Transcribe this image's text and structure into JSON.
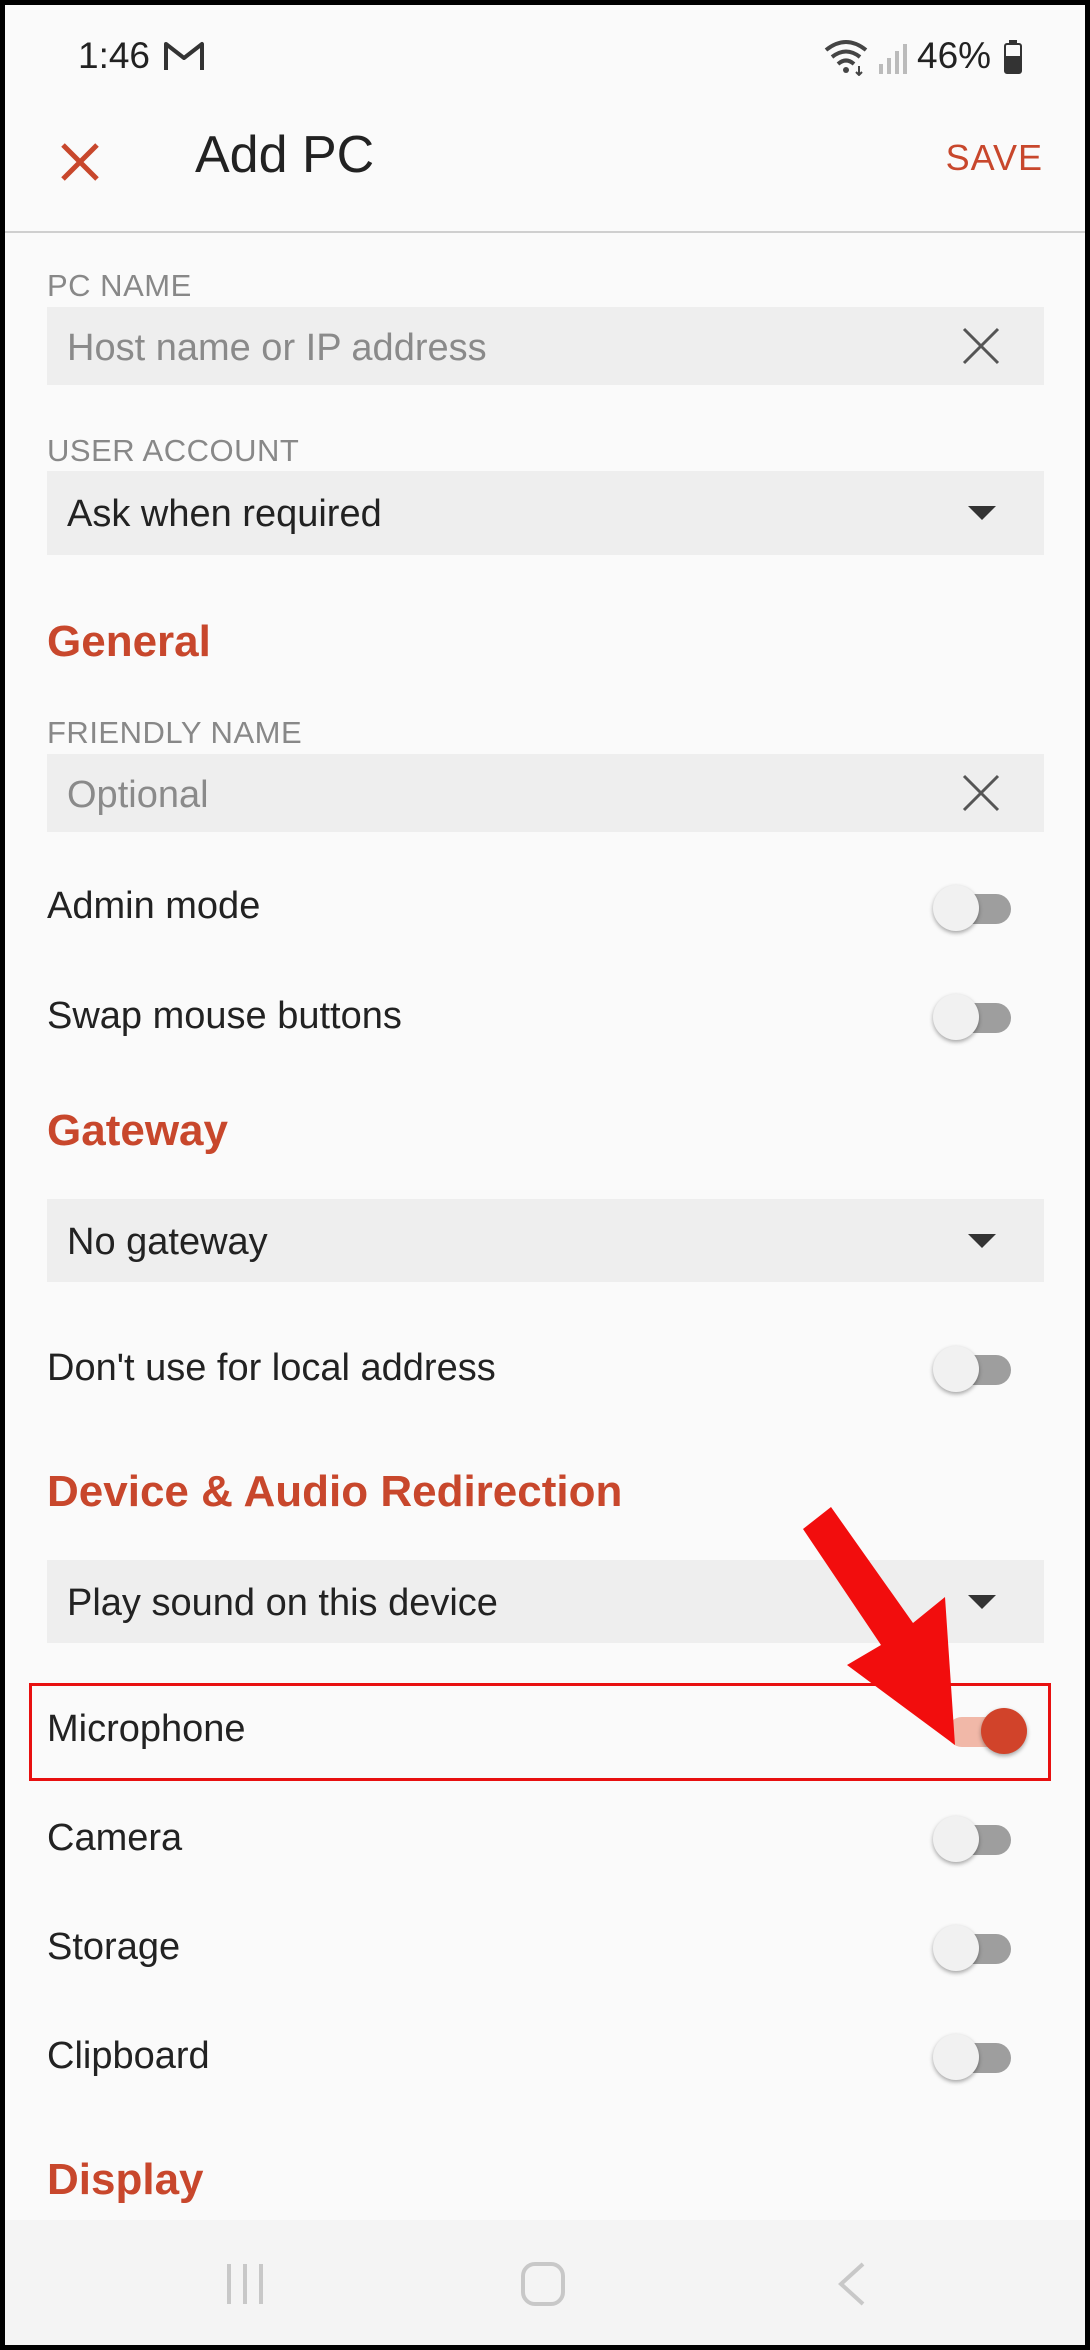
{
  "status": {
    "time": "1:46",
    "battery": "46%"
  },
  "appbar": {
    "title": "Add PC",
    "save": "SAVE"
  },
  "pc_name": {
    "label": "PC NAME",
    "placeholder": "Host name or IP address"
  },
  "user_account": {
    "label": "USER ACCOUNT",
    "value": "Ask when required"
  },
  "general": {
    "heading": "General",
    "friendly_label": "FRIENDLY NAME",
    "friendly_placeholder": "Optional",
    "admin_mode": "Admin mode",
    "swap_mouse": "Swap mouse buttons"
  },
  "gateway": {
    "heading": "Gateway",
    "value": "No gateway",
    "local_address": "Don't use for local address"
  },
  "device": {
    "heading": "Device & Audio Redirection",
    "sound": "Play sound on this device",
    "microphone": "Microphone",
    "camera": "Camera",
    "storage": "Storage",
    "clipboard": "Clipboard"
  },
  "display": {
    "heading": "Display"
  },
  "toggles": {
    "admin_mode": false,
    "swap_mouse": false,
    "local_address": false,
    "microphone": true,
    "camera": false,
    "storage": false,
    "clipboard": false
  },
  "colors": {
    "accent": "#c8472c",
    "annotation": "#e81010"
  },
  "icons": [
    "gmail-icon",
    "wifi-icon",
    "signal-icon",
    "battery-icon",
    "close-icon",
    "clear-icon",
    "dropdown-icon",
    "recent-apps-icon",
    "home-icon",
    "back-icon"
  ]
}
